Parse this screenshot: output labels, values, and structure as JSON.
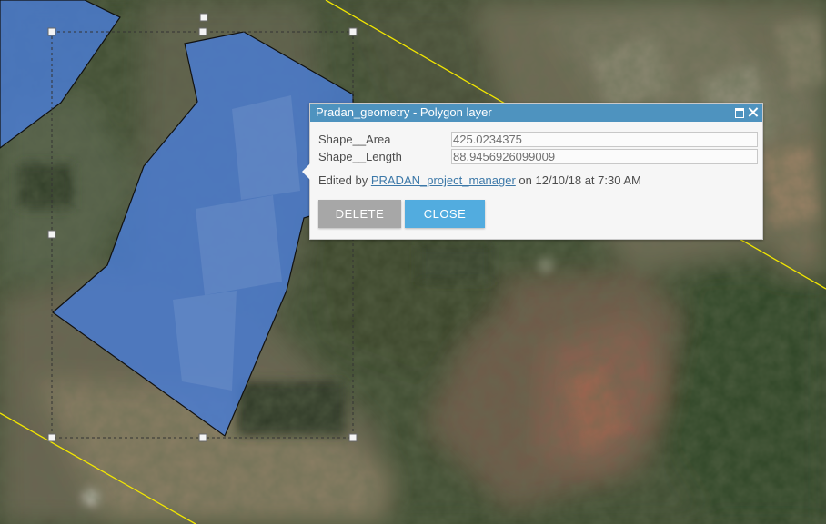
{
  "popup": {
    "title": "Pradan_geometry - Polygon layer",
    "fields": [
      {
        "label": "Shape__Area",
        "value": "425.0234375"
      },
      {
        "label": "Shape__Length",
        "value": "88.9456926099009"
      }
    ],
    "edited": {
      "prefix": "Edited by ",
      "user": "PRADAN_project_manager",
      "suffix": " on 12/10/18 at 7:30 AM"
    },
    "buttons": {
      "delete": "DELETE",
      "close": "CLOSE"
    }
  },
  "colors": {
    "header": "#4e93bf",
    "close_button": "#52acdf",
    "delete_button": "#a7a7a7",
    "polygon_fill": "#4a7bd0",
    "parcel_line": "#f2e600"
  }
}
